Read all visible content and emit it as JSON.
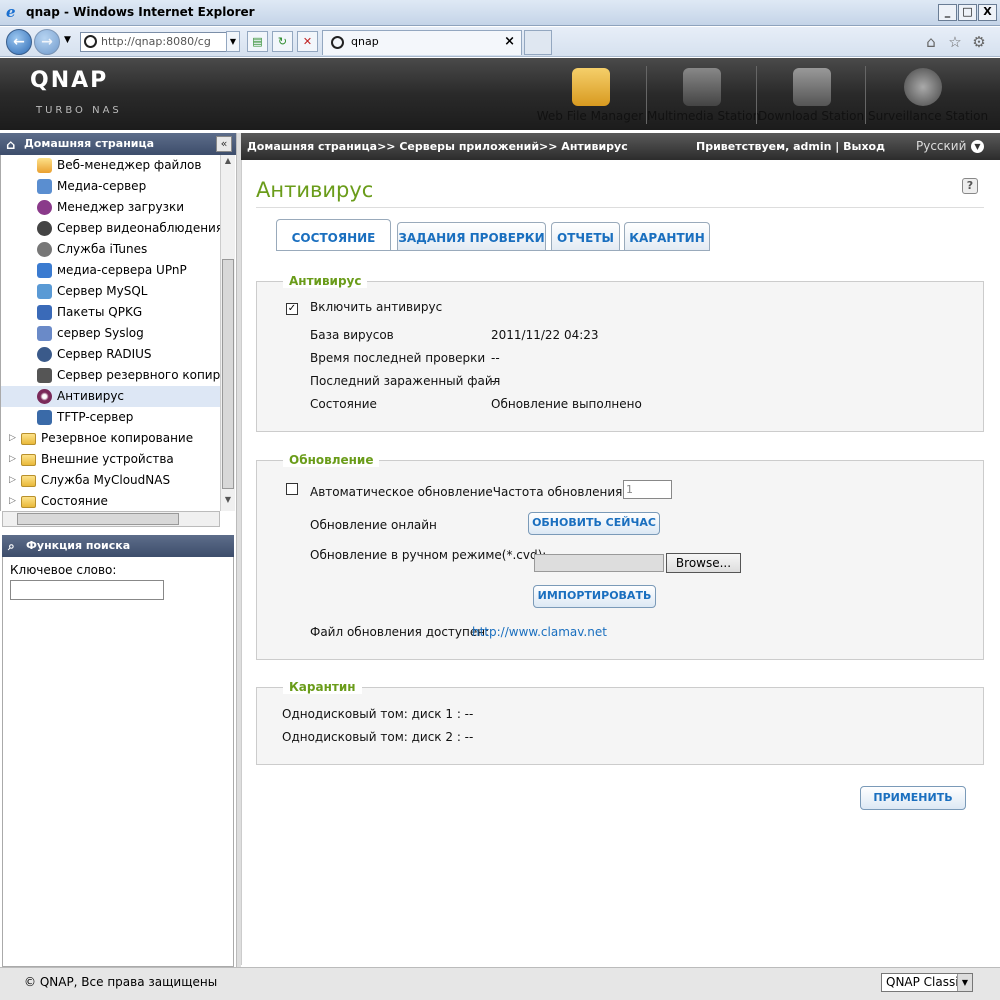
{
  "window": {
    "title": "qnap - Windows Internet Explorer",
    "min": "_",
    "max": "□",
    "close": "X"
  },
  "browser": {
    "address": "http://qnap:8080/cg",
    "tab_title": "qnap",
    "tab_close": "×"
  },
  "header": {
    "logo": "QNAP",
    "sublogo": "TURBO NAS",
    "apps": [
      {
        "label": "Web File Manager",
        "icon": "folder-magnifier-icon",
        "color": "#e0a030"
      },
      {
        "label": "Multimedia Station",
        "icon": "multimedia-icon",
        "color": "#777777"
      },
      {
        "label": "Download Station",
        "icon": "download-icon",
        "color": "#888888"
      },
      {
        "label": "Surveillance Station",
        "icon": "camera-icon",
        "color": "#999999"
      }
    ]
  },
  "sidebar": {
    "header": "Домашняя страница",
    "items": [
      {
        "label": "Веб-менеджер файлов",
        "icon": "folder-icon",
        "color": "#f0b040"
      },
      {
        "label": "Медиа-сервер",
        "icon": "media-icon",
        "color": "#5a8ed0"
      },
      {
        "label": "Менеджер загрузки",
        "icon": "download-icon",
        "color": "#8a3a8a"
      },
      {
        "label": "Сервер видеонаблюдения",
        "icon": "camera-icon",
        "color": "#444444"
      },
      {
        "label": "Служба iTunes",
        "icon": "apple-icon",
        "color": "#666666"
      },
      {
        "label": "медиа-сервера UPnP",
        "icon": "upnp-icon",
        "color": "#3b7bd0"
      },
      {
        "label": "Сервер MySQL",
        "icon": "mysql-icon",
        "color": "#5a9ad5"
      },
      {
        "label": "Пакеты QPKG",
        "icon": "qpkg-icon",
        "color": "#3a6ab8"
      },
      {
        "label": "сервер Syslog",
        "icon": "syslog-icon",
        "color": "#6a8ac8"
      },
      {
        "label": "Сервер RADIUS",
        "icon": "radius-icon",
        "color": "#3a5a8a"
      },
      {
        "label": "Сервер резервного копирова",
        "icon": "backup-server-icon",
        "color": "#555555"
      },
      {
        "label": "Антивирус",
        "icon": "antivirus-icon",
        "color": "#7a2a5a"
      },
      {
        "label": "TFTP-сервер",
        "icon": "tftp-icon",
        "color": "#3a6aa8"
      }
    ],
    "folders": [
      {
        "label": "Резервное копирование"
      },
      {
        "label": "Внешние устройства"
      },
      {
        "label": "Служба MyCloudNAS"
      },
      {
        "label": "Состояние"
      }
    ],
    "collapse": "«"
  },
  "search": {
    "header": "Функция поиска",
    "keyword_label": "Ключевое слово:",
    "keyword_value": ""
  },
  "topbar": {
    "breadcrumb": "Домашняя страница>> Серверы приложений>> Антивирус",
    "welcome": "Приветствуем, admin | Выход",
    "language": "Русский"
  },
  "page": {
    "title": "Антивирус",
    "help": "?",
    "tabs": [
      "СОСТОЯНИЕ",
      "ЗАДАНИЯ ПРОВЕРКИ",
      "ОТЧЕТЫ",
      "КАРАНТИН"
    ],
    "antivirus": {
      "legend": "Антивирус",
      "enable_label": "Включить антивирус",
      "enable_checked": "✓",
      "rows": [
        {
          "label": "База вирусов",
          "value": "2011/11/22 04:23"
        },
        {
          "label": "Время последней проверки",
          "value": "--"
        },
        {
          "label": "Последний зараженный файл",
          "value": "--"
        },
        {
          "label": "Состояние",
          "value": "Обновление выполнено"
        }
      ]
    },
    "update": {
      "legend": "Обновление",
      "auto_label": "Автоматическое обновлениеЧастота обновления(дни):",
      "frequency": "1",
      "online_label": "Обновление онлайн",
      "update_now": "ОБНОВИТЬ СЕЙЧАС",
      "manual_label": "Обновление в ручном режиме(*.cvd):",
      "browse": "Browse...",
      "import": "ИМПОРТИРОВАТЬ",
      "available_label": "Файл обновления доступен:",
      "available_link": "http://www.clamav.net"
    },
    "quarantine": {
      "legend": "Карантин",
      "rows": [
        "Однодисковый том: диск 1 : --",
        "Однодисковый том: диск 2 : --"
      ]
    },
    "apply": "ПРИМЕНИТЬ"
  },
  "footer": {
    "copyright": "© QNAP, Все права защищены",
    "skin": "QNAP Classic"
  }
}
